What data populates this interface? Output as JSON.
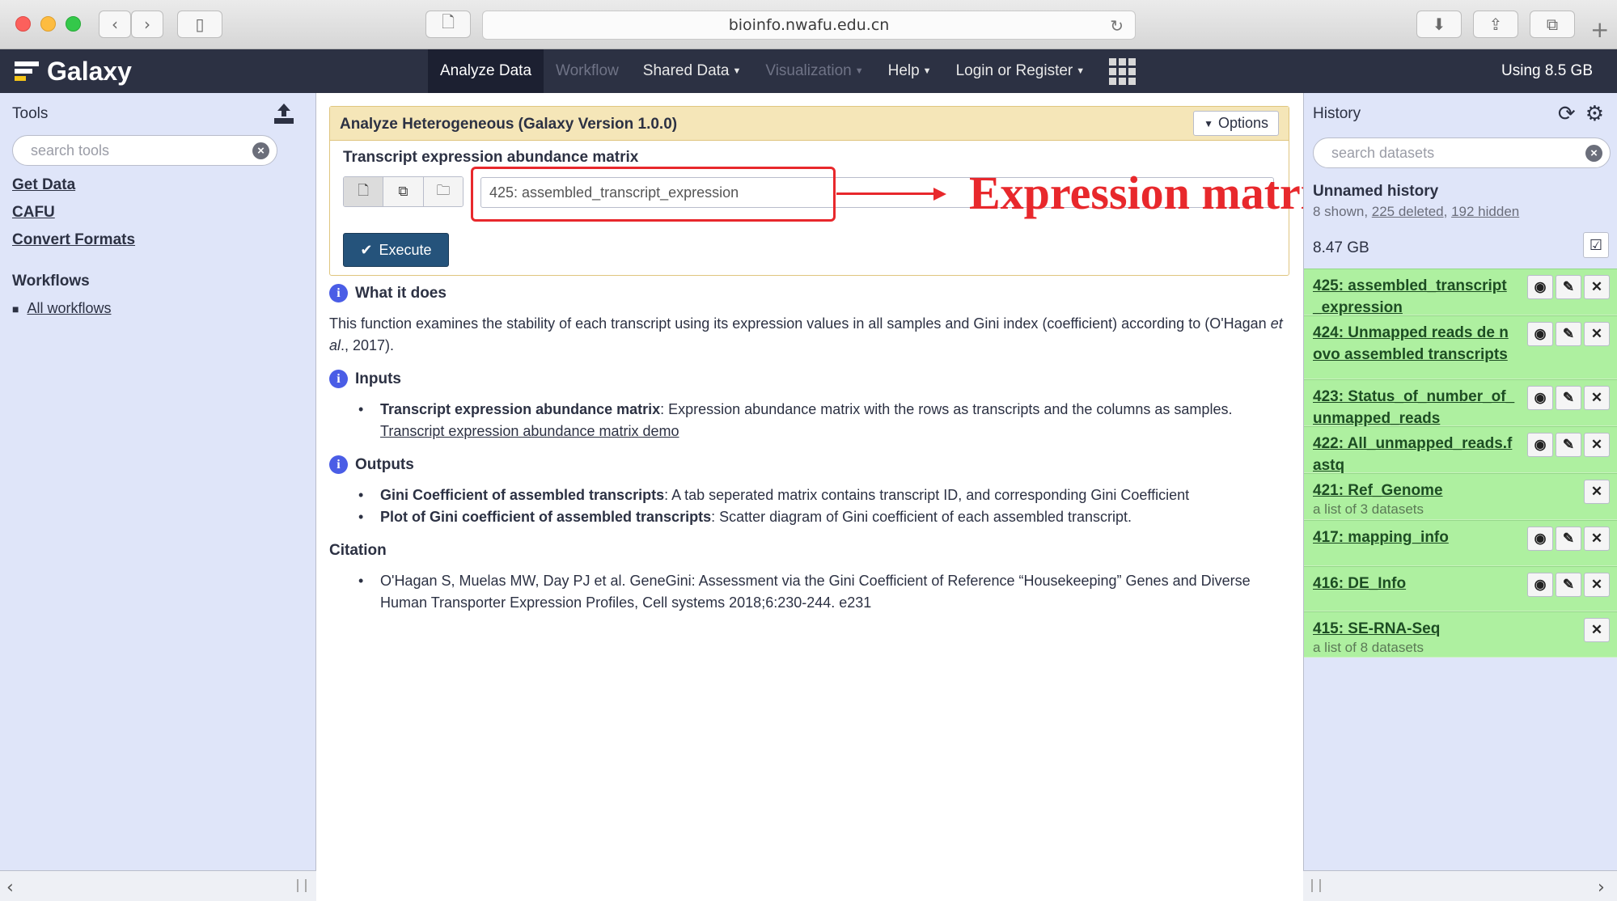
{
  "browser": {
    "url": "bioinfo.nwafu.edu.cn"
  },
  "masthead": {
    "brand": "Galaxy",
    "nav": [
      {
        "label": "Analyze Data",
        "state": "active"
      },
      {
        "label": "Workflow",
        "state": "disabled"
      },
      {
        "label": "Shared Data",
        "state": "normal"
      },
      {
        "label": "Visualization",
        "state": "disabled"
      },
      {
        "label": "Help",
        "state": "normal"
      },
      {
        "label": "Login or Register",
        "state": "normal"
      }
    ],
    "usage": "Using 8.5 GB"
  },
  "tools_panel": {
    "title": "Tools",
    "search_placeholder": "search tools",
    "links": [
      "Get Data",
      "CAFU",
      "Convert Formats"
    ],
    "workflows_title": "Workflows",
    "workflows_link": "All workflows"
  },
  "tool_form": {
    "title": "Analyze Heterogeneous (Galaxy Version 1.0.0)",
    "options_label": "Options",
    "param_label": "Transcript expression abundance matrix",
    "selected_value": "425: assembled_transcript_expression",
    "execute_label": "Execute"
  },
  "annotation": {
    "text": "Expression matrix"
  },
  "help": {
    "what_title": "What it does",
    "what_text_1": "This function examines the stability of each transcript using its expression values in all samples and Gini index (coefficient) according to (O'Hagan ",
    "what_text_em": "et al",
    "what_text_2": "., 2017).",
    "inputs_title": "Inputs",
    "inputs_item_bold": "Transcript expression abundance matrix",
    "inputs_item_text": ": Expression abundance matrix with the rows as transcripts and the columns as samples. ",
    "inputs_item_link": "Transcript expression abundance matrix demo",
    "outputs_title": "Outputs",
    "output1_bold": "Gini Coefficient of assembled transcripts",
    "output1_text": ": A tab seperated matrix contains transcript ID, and corresponding Gini Coefficient",
    "output2_bold": "Plot of Gini coefficient of assembled transcripts",
    "output2_text": ": Scatter diagram of Gini coefficient of each assembled transcript.",
    "citation_title": "Citation",
    "citation_text": "O'Hagan S, Muelas MW, Day PJ et al. GeneGini: Assessment via the Gini Coefficient of Reference “Housekeeping” Genes and Diverse Human Transporter Expression Profiles, Cell systems 2018;6:230-244. e231"
  },
  "history_panel": {
    "title": "History",
    "search_placeholder": "search datasets",
    "name": "Unnamed history",
    "shown_text": "8 shown, ",
    "deleted_text": "225 deleted",
    "hidden_text": "192 hidden",
    "size": "8.47 GB",
    "datasets": [
      {
        "title": "425: assembled_transcript_expression",
        "sub": ""
      },
      {
        "title": "424: Unmapped reads de novo assembled transcripts",
        "sub": ""
      },
      {
        "title": "423: Status_of_number_of_unmapped_reads",
        "sub": ""
      },
      {
        "title": "422: All_unmapped_reads.fastq",
        "sub": ""
      },
      {
        "title": "421: Ref_Genome",
        "sub": "a list of 3 datasets"
      },
      {
        "title": "417: mapping_info",
        "sub": ""
      },
      {
        "title": "416: DE_Info",
        "sub": ""
      },
      {
        "title": "415: SE-RNA-Seq",
        "sub": "a list of 8 datasets"
      }
    ]
  },
  "colors": {
    "masthead": "#2c3143",
    "panel": "#dfe5f9",
    "dataset_ok": "#aef0a0",
    "execute": "#25537b",
    "annotation": "#e8282c"
  }
}
